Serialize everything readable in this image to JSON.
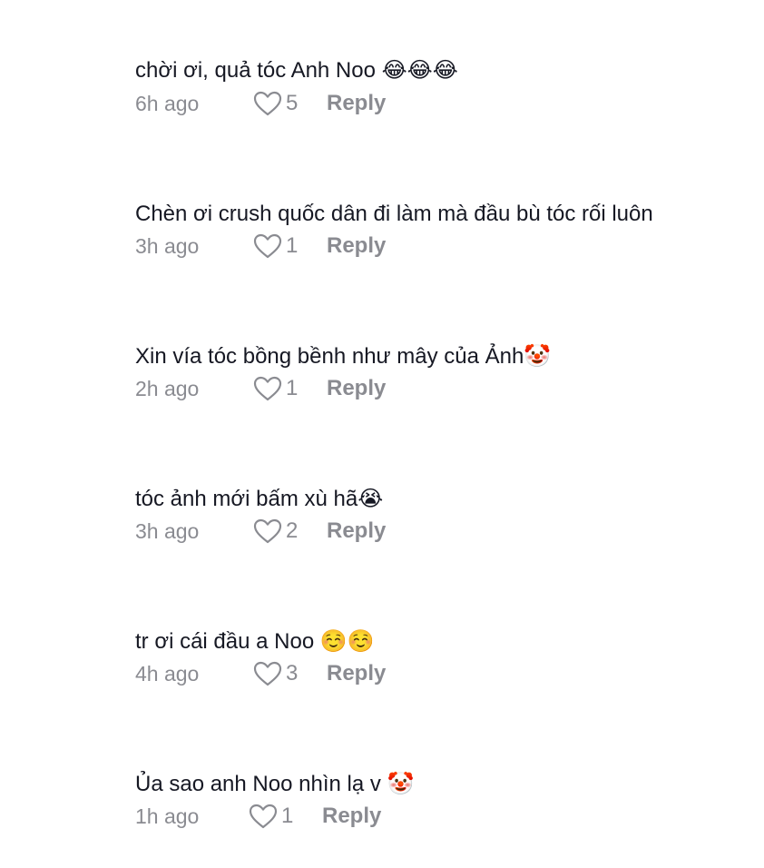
{
  "comments": [
    {
      "text": "chời ơi, quả tóc Anh Noo 😂😂😂",
      "time": "6h ago",
      "likes": "5",
      "reply_label": "Reply"
    },
    {
      "text": "Chèn ơi crush quốc dân đi làm mà đầu bù tóc rối luôn",
      "time": "3h ago",
      "likes": "1",
      "reply_label": "Reply"
    },
    {
      "text": "Xin vía tóc bồng bềnh như mây của Ảnh🤡",
      "time": "2h ago",
      "likes": "1",
      "reply_label": "Reply"
    },
    {
      "text": "tóc ảnh mới bấm xù hã😭",
      "time": "3h ago",
      "likes": "2",
      "reply_label": "Reply"
    },
    {
      "text": "tr ơi cái đầu a Noo ☺️☺️",
      "time": "4h ago",
      "likes": "3",
      "reply_label": "Reply"
    },
    {
      "text": "Ủa sao anh Noo nhìn lạ v 🤡",
      "time": "1h ago",
      "likes": "1",
      "reply_label": "Reply"
    }
  ],
  "icons": {
    "like": "heart-outline-icon"
  },
  "colors": {
    "text": "#161823",
    "secondary": "#8a8b91",
    "background": "#ffffff"
  }
}
